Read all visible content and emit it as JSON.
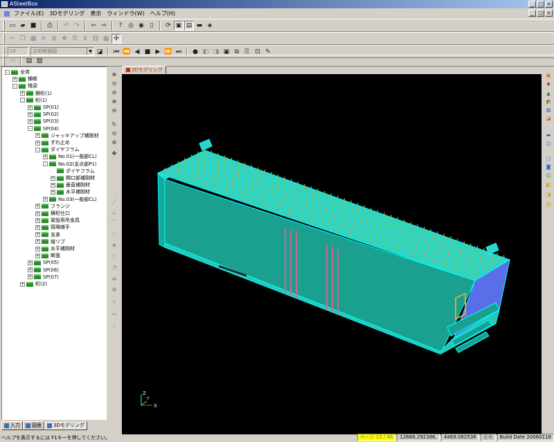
{
  "window": {
    "title": "ASteelBox",
    "title_buttons": [
      "_",
      "□",
      "×"
    ],
    "mdi_buttons": [
      "_",
      "□",
      "×"
    ]
  },
  "menu": {
    "items": [
      "ファイル(E)",
      "3Dモデリング",
      "表示",
      "ウィンドウ(W)",
      "ヘルプ(H)"
    ]
  },
  "toolbar3": {
    "combo1": "16",
    "combo2": "主桁断面図"
  },
  "tree": {
    "rows": [
      {
        "label": "全体",
        "level": 0,
        "pm": "-"
      },
      {
        "label": "横断",
        "level": 1,
        "pm": "+"
      },
      {
        "label": "桟梁",
        "level": 1,
        "pm": "-"
      },
      {
        "label": "横桁(1)",
        "level": 2,
        "pm": "+"
      },
      {
        "label": "桁(1)",
        "level": 2,
        "pm": "-"
      },
      {
        "label": "SP(01)",
        "level": 3,
        "pm": "+"
      },
      {
        "label": "SP(02)",
        "level": 3,
        "pm": "+"
      },
      {
        "label": "SP(03)",
        "level": 3,
        "pm": "+"
      },
      {
        "label": "SP(04)",
        "level": 3,
        "pm": "-"
      },
      {
        "label": "ジャッキアップ補剛材",
        "level": 4,
        "pm": "+"
      },
      {
        "label": "ずれ止め",
        "level": 4,
        "pm": "+"
      },
      {
        "label": "ダイヤフラム",
        "level": 4,
        "pm": "-"
      },
      {
        "label": "No.01(一般部CL)",
        "level": 5,
        "pm": "+"
      },
      {
        "label": "No.02(支点部P1)",
        "level": 5,
        "pm": "-"
      },
      {
        "label": "ダイヤフラム",
        "level": 6,
        "pm": ""
      },
      {
        "label": "開口部補剛材",
        "level": 6,
        "pm": "+"
      },
      {
        "label": "垂直補剛材",
        "level": 6,
        "pm": "+"
      },
      {
        "label": "水平補剛材",
        "level": 6,
        "pm": "+"
      },
      {
        "label": "No.03(一般部CL)",
        "level": 5,
        "pm": "+"
      },
      {
        "label": "フランジ",
        "level": 4,
        "pm": "+"
      },
      {
        "label": "横桁仕口",
        "level": 4,
        "pm": "+"
      },
      {
        "label": "架設用吊金具",
        "level": 4,
        "pm": "+"
      },
      {
        "label": "現場継手",
        "level": 4,
        "pm": "+"
      },
      {
        "label": "支承",
        "level": 4,
        "pm": "+"
      },
      {
        "label": "縦リブ",
        "level": 4,
        "pm": "+"
      },
      {
        "label": "水平補剛材",
        "level": 4,
        "pm": "+"
      },
      {
        "label": "断面",
        "level": 4,
        "pm": "+"
      },
      {
        "label": "SP(05)",
        "level": 3,
        "pm": "+"
      },
      {
        "label": "SP(06)",
        "level": 3,
        "pm": "+"
      },
      {
        "label": "SP(07)",
        "level": 3,
        "pm": "+"
      },
      {
        "label": "桁(2)",
        "level": 2,
        "pm": "+"
      }
    ]
  },
  "bottom_tabs": [
    "入力",
    "図面",
    "3Dモデリング"
  ],
  "view_tab": "3Dモデリング",
  "axes": {
    "x": "X",
    "y": "Y",
    "z": "Z"
  },
  "status": {
    "help": "ヘルプを表示するには F1キーを押してください。",
    "page": "ページ 15 / 46",
    "coord_x": "12666.292386,",
    "coord_y": "4469.082538",
    "mode": "直角",
    "build": "Build Date 20060118"
  },
  "colors": {
    "model_face": "#1aa08f",
    "model_top": "#2fd4c4",
    "model_edge": "#00ffff",
    "stiffener": "#d9628c",
    "diaphragm": "#5a6ee8"
  }
}
